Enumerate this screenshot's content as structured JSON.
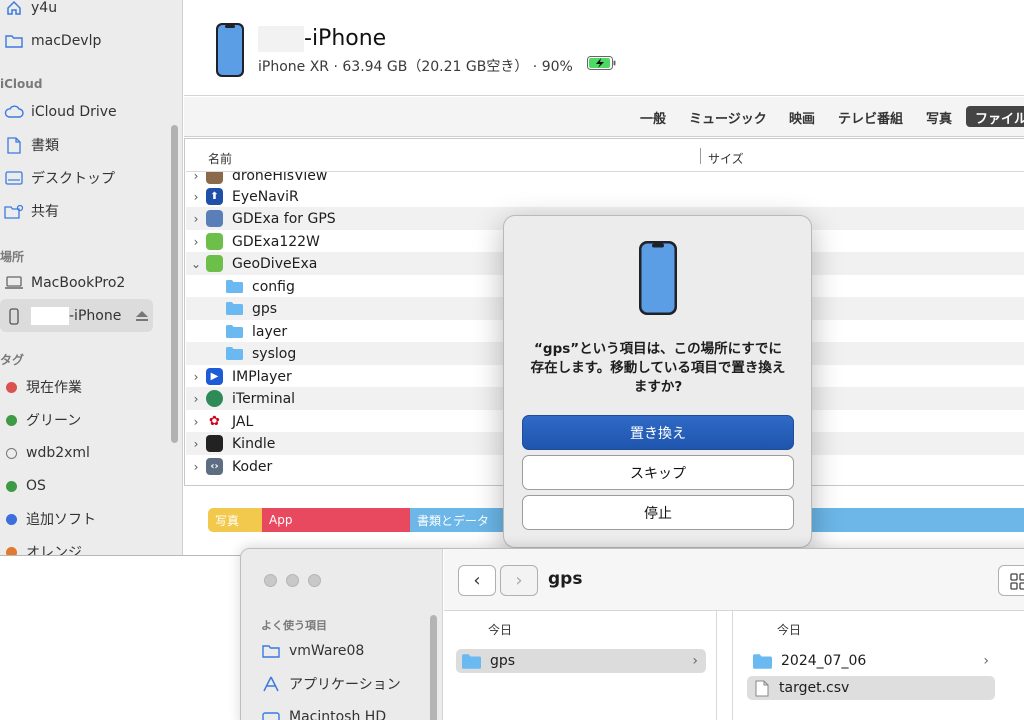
{
  "sidebar": {
    "top_items": [
      {
        "label": "y4u",
        "icon": "house-icon"
      },
      {
        "label": "macDevlp",
        "icon": "folder-icon"
      }
    ],
    "icloud_header": "iCloud",
    "icloud_items": [
      {
        "label": "iCloud Drive",
        "icon": "cloud-icon"
      },
      {
        "label": "書類",
        "icon": "document-icon"
      },
      {
        "label": "デスクトップ",
        "icon": "desktop-icon"
      },
      {
        "label": "共有",
        "icon": "shared-folder-icon"
      }
    ],
    "locations_header": "場所",
    "locations": [
      {
        "label": "MacBookPro2",
        "icon": "laptop-icon"
      },
      {
        "label": "-iPhone",
        "icon": "iphone-icon"
      }
    ],
    "tags_header": "タグ",
    "tags": [
      {
        "label": "現在作業",
        "color": "#d9534f"
      },
      {
        "label": "グリーン",
        "color": "#3f9a45"
      },
      {
        "label": "wdb2xml",
        "color": ""
      },
      {
        "label": "OS",
        "color": "#3f9a45"
      },
      {
        "label": "追加ソフト",
        "color": "#3b6fdc"
      },
      {
        "label": "オレンジ",
        "color": "#e07a2f"
      }
    ]
  },
  "device": {
    "name": "-iPhone",
    "info": "iPhone XR · 63.94 GB（20.21 GB空き） · 90%"
  },
  "tabs": [
    "一般",
    "ミュージック",
    "映画",
    "テレビ番組",
    "写真",
    "ファイル"
  ],
  "list": {
    "col_name": "名前",
    "col_size": "サイズ",
    "rows": [
      {
        "label": "droneHisView",
        "type": "app",
        "expanded": false,
        "color": "#8a6a4a"
      },
      {
        "label": "EyeNaviR",
        "type": "app",
        "expanded": false,
        "color": "#1f4fa8"
      },
      {
        "label": "GDExa for GPS",
        "type": "app",
        "expanded": false,
        "color": "#5a7fb8"
      },
      {
        "label": "GDExa122W",
        "type": "app",
        "expanded": false,
        "color": "#6cc04a"
      },
      {
        "label": "GeoDiveExa",
        "type": "app",
        "expanded": true,
        "color": "#6cc04a"
      },
      {
        "label": "config",
        "type": "folder"
      },
      {
        "label": "gps",
        "type": "folder"
      },
      {
        "label": "layer",
        "type": "folder"
      },
      {
        "label": "syslog",
        "type": "folder"
      },
      {
        "label": "IMPlayer",
        "type": "app",
        "expanded": false,
        "color": "#1e5bd6"
      },
      {
        "label": "iTerminal",
        "type": "app",
        "expanded": false,
        "color": "#2e8b57"
      },
      {
        "label": "JAL",
        "type": "app",
        "expanded": false,
        "color": "#d0021b"
      },
      {
        "label": "Kindle",
        "type": "app",
        "expanded": false,
        "color": "#222222"
      },
      {
        "label": "Koder",
        "type": "app",
        "expanded": false,
        "color": "#5d6e82"
      }
    ]
  },
  "storage": [
    {
      "label": "写真",
      "color": "#f2c94c"
    },
    {
      "label": "App",
      "color": "#e8495f"
    },
    {
      "label": "書類とデータ",
      "color": "#6cb7e8"
    }
  ],
  "dialog": {
    "message": "“gps”という項目は、この場所にすでに存在します。移動している項目で置き換えますか?",
    "replace": "置き換え",
    "skip": "スキップ",
    "stop": "停止"
  },
  "finder2": {
    "title": "gps",
    "favorites_header": "よく使う項目",
    "favorites": [
      {
        "label": "vmWare08",
        "icon": "folder-icon"
      },
      {
        "label": "アプリケーション",
        "icon": "applications-icon"
      },
      {
        "label": "Macintosh HD",
        "icon": "disk-icon"
      }
    ],
    "column1_header": "今日",
    "column1_items": [
      "gps"
    ],
    "column2_header": "今日",
    "column2_items": [
      "2024_07_06",
      "target.csv"
    ]
  }
}
